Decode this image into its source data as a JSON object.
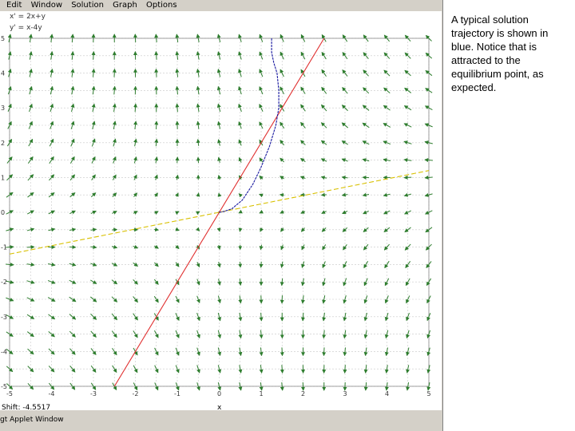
{
  "menubar": {
    "items": [
      "Edit",
      "Window",
      "Solution",
      "Graph",
      "Options"
    ]
  },
  "equations": {
    "line1": "x' = 2x+y",
    "line2": "y' = x-4y"
  },
  "status": {
    "coords": "Shift: -4.5517",
    "axis_letter": "x",
    "window_label": "gt Applet Window"
  },
  "caption": "A typical solution trajectory is shown in blue.  Notice that is attracted to the equilibrium point, as expected.",
  "colors": {
    "field_arrows": "#2e7d2e",
    "solution_trajectory": "#1a1aa0",
    "nullcline_red": "#e03030",
    "nullcline_yellow": "#d8c000",
    "grid": "#c8c8c8",
    "panel": "#d4d0c8"
  },
  "chart_data": {
    "type": "direction-field",
    "xlim": [
      -5,
      5
    ],
    "ylim": [
      -5,
      5
    ],
    "x_ticks": [
      "-5",
      "-4",
      "-3",
      "-2",
      "-1",
      "0",
      "1",
      "2",
      "3",
      "4",
      "5"
    ],
    "y_ticks": [
      "5",
      "4",
      "3",
      "2",
      "1",
      "0",
      "-1",
      "-2",
      "-3",
      "-4",
      "-5"
    ],
    "grid": true,
    "series": [
      {
        "name": "",
        "kind": "line",
        "color": "red",
        "points": [
          [
            -2.5,
            -5
          ],
          [
            2.5,
            5
          ]
        ]
      },
      {
        "name": "",
        "kind": "line",
        "color": "yellow",
        "points": [
          [
            -5,
            -1.2
          ],
          [
            5,
            1.2
          ]
        ]
      },
      {
        "name": "",
        "kind": "trajectory",
        "color": "blue",
        "points": [
          [
            1.25,
            5
          ],
          [
            1.25,
            4.6
          ],
          [
            1.3,
            4.3
          ],
          [
            1.38,
            4.0
          ],
          [
            1.42,
            3.5
          ],
          [
            1.42,
            3.0
          ],
          [
            1.35,
            2.5
          ],
          [
            1.2,
            1.9
          ],
          [
            1.0,
            1.3
          ],
          [
            0.8,
            0.8
          ],
          [
            0.55,
            0.35
          ],
          [
            0.3,
            0.1
          ],
          [
            0.1,
            0.02
          ],
          [
            0,
            0
          ]
        ]
      }
    ]
  }
}
